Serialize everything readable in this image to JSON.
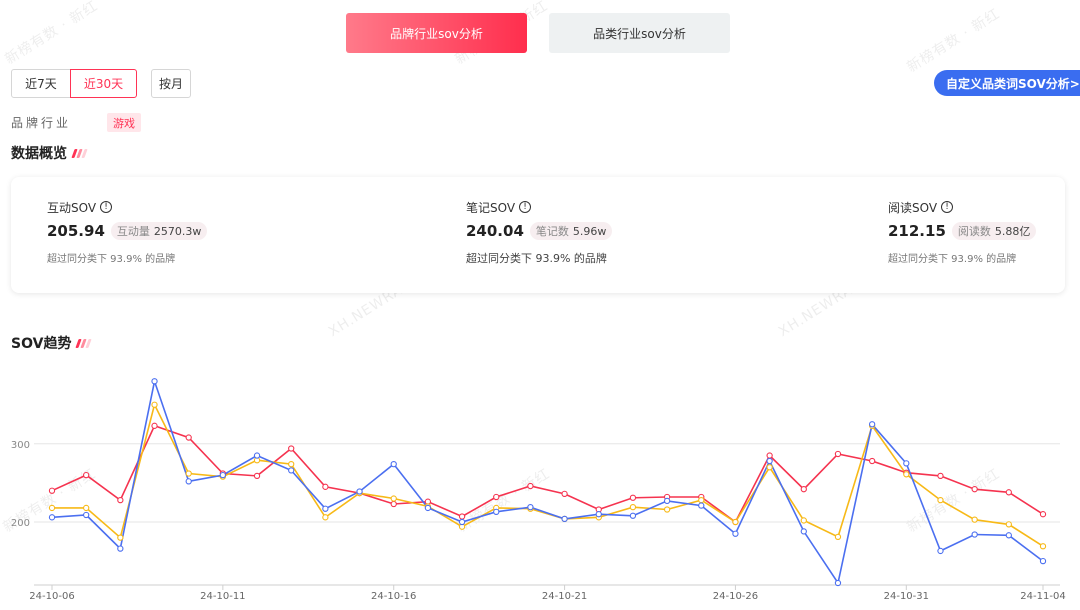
{
  "tabs": [
    {
      "label": "品牌行业sov分析",
      "active": true
    },
    {
      "label": "品类行业sov分析",
      "active": false
    }
  ],
  "range_buttons": {
    "last7": "近7天",
    "last30": "近30天",
    "monthly": "按月",
    "selected": "近30天"
  },
  "custom_sov_button": "自定义品类词SOV分析>",
  "industry": {
    "label": "品牌行业",
    "tag": "游戏"
  },
  "overview": {
    "title": "数据概览",
    "metrics": [
      {
        "title": "互动SOV",
        "value": "205.94",
        "badge_label": "互动量",
        "badge_value": "2570.3w",
        "footnote": "超过同分类下 93.9% 的品牌"
      },
      {
        "title": "笔记SOV",
        "value": "240.04",
        "badge_label": "笔记数",
        "badge_value": "5.96w",
        "footnote": "超过同分类下 93.9% 的品牌"
      },
      {
        "title": "阅读SOV",
        "value": "212.15",
        "badge_label": "阅读数",
        "badge_value": "5.88亿",
        "footnote": "超过同分类下 93.9% 的品牌"
      }
    ]
  },
  "trend": {
    "title": "SOV趋势"
  },
  "watermarks": [
    "新榜有数 · 新红",
    "XH.NEWRANK.CN"
  ],
  "chart_data": {
    "type": "line",
    "x": [
      "24-10-06",
      "24-10-07",
      "24-10-08",
      "24-10-09",
      "24-10-10",
      "24-10-11",
      "24-10-12",
      "24-10-13",
      "24-10-14",
      "24-10-15",
      "24-10-16",
      "24-10-17",
      "24-10-18",
      "24-10-19",
      "24-10-20",
      "24-10-21",
      "24-10-22",
      "24-10-23",
      "24-10-24",
      "24-10-25",
      "24-10-26",
      "24-10-27",
      "24-10-28",
      "24-10-29",
      "24-10-30",
      "24-10-31",
      "24-11-01",
      "24-11-02",
      "24-11-03",
      "24-11-04"
    ],
    "x_tick_labels": [
      "24-10-06",
      "24-10-11",
      "24-10-16",
      "24-10-21",
      "24-10-26",
      "24-10-31",
      "24-11-04"
    ],
    "y_ticks": [
      200,
      300
    ],
    "ylim": [
      122,
      388
    ],
    "grid": true,
    "series": [
      {
        "color": "#f5334f",
        "values": [
          240,
          260,
          228,
          323,
          308,
          262,
          259,
          294,
          245,
          237,
          223,
          226,
          207,
          232,
          246,
          236,
          216,
          231,
          232,
          232,
          200,
          285,
          242,
          287,
          278,
          263,
          259,
          242,
          238,
          210
        ]
      },
      {
        "color": "#f7b917",
        "values": [
          218,
          218,
          180,
          350,
          262,
          258,
          279,
          274,
          206,
          237,
          230,
          220,
          194,
          218,
          217,
          204,
          206,
          219,
          216,
          228,
          200,
          270,
          202,
          181,
          323,
          261,
          228,
          203,
          197,
          169
        ]
      },
      {
        "color": "#4b6ff0",
        "values": [
          206,
          209,
          166,
          380,
          252,
          260,
          285,
          266,
          217,
          239,
          274,
          218,
          200,
          213,
          219,
          204,
          210,
          208,
          227,
          221,
          185,
          278,
          188,
          122,
          325,
          275,
          163,
          184,
          183,
          150
        ]
      }
    ]
  }
}
